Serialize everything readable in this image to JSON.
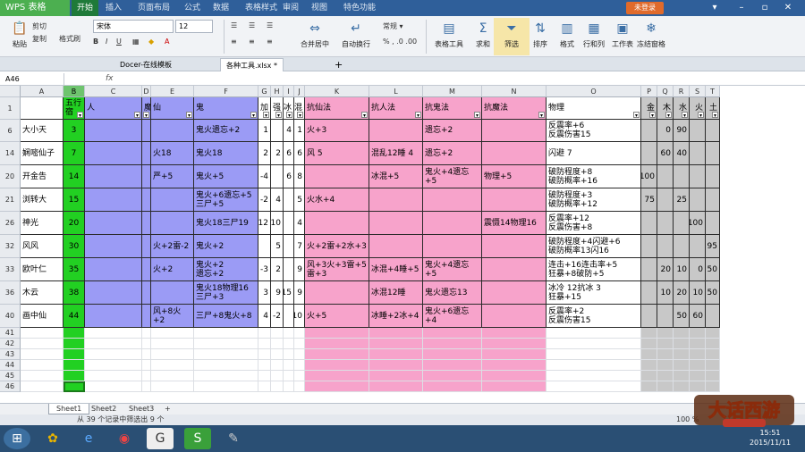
{
  "app": {
    "name": "WPS 表格",
    "menu_tabs": [
      "开始",
      "插入",
      "页面布局",
      "公式",
      "数据",
      "表格样式",
      "审阅",
      "视图",
      "特色功能"
    ],
    "login_label": "未登录"
  },
  "ribbon": {
    "paste": "粘贴",
    "cut": "剪切",
    "copy": "复制",
    "format_painter": "格式刷",
    "font_name": "宋体",
    "font_size": "12",
    "merge_center": "合并居中",
    "wrap_text": "自动换行",
    "sum": "求和",
    "filter": "筛选",
    "sort": "排序",
    "format": "格式",
    "row_col": "行和列",
    "worksheet": "工作表",
    "freeze": "冻结窗格",
    "insert_del": "表格工具",
    "condition": "条件格式"
  },
  "doc_tabs": [
    "Docer-在线模板",
    "各种工具.xlsx *"
  ],
  "formula_bar": {
    "name_box": "A46",
    "fx": "fx"
  },
  "columns": [
    {
      "id": "A",
      "sel": false
    },
    {
      "id": "B",
      "sel": true
    },
    {
      "id": "C",
      "sel": false
    },
    {
      "id": "D",
      "sel": false
    },
    {
      "id": "E",
      "sel": false
    },
    {
      "id": "F",
      "sel": false
    },
    {
      "id": "G",
      "sel": false
    },
    {
      "id": "H",
      "sel": false
    },
    {
      "id": "I",
      "sel": false
    },
    {
      "id": "J",
      "sel": false
    },
    {
      "id": "K",
      "sel": false
    },
    {
      "id": "L",
      "sel": false
    },
    {
      "id": "M",
      "sel": false
    },
    {
      "id": "N",
      "sel": false
    },
    {
      "id": "O",
      "sel": false
    },
    {
      "id": "P",
      "sel": false
    },
    {
      "id": "Q",
      "sel": false
    },
    {
      "id": "R",
      "sel": false
    },
    {
      "id": "S",
      "sel": false
    },
    {
      "id": "T",
      "sel": false
    }
  ],
  "header_row": {
    "row": "1",
    "cells": [
      "",
      "五行宿",
      "人",
      "魔",
      "仙",
      "鬼",
      "加",
      "强",
      "冰",
      "混",
      "抗仙法",
      "抗人法",
      "抗鬼法",
      "抗魔法",
      "物理",
      "金",
      "木",
      "水",
      "火",
      "土"
    ]
  },
  "rows": [
    {
      "row": "6",
      "cells": [
        "大小天",
        "3",
        "",
        "",
        "",
        "鬼火遗忘+2",
        "1",
        "",
        "4",
        "1",
        "火+3",
        "",
        "遗忘+2",
        "",
        "反震率+6\n反震伤害15",
        "",
        "0",
        "90",
        "",
        ""
      ]
    },
    {
      "row": "14",
      "cells": [
        "娴嘧仙子",
        "7",
        "",
        "",
        "火18",
        "鬼火18",
        "2",
        "2",
        "6",
        "6",
        "风 5",
        "混乱12睡 4",
        "遗忘+2",
        "",
        "闪避 7",
        "",
        "60",
        "40",
        "",
        ""
      ]
    },
    {
      "row": "20",
      "cells": [
        "开金告",
        "14",
        "",
        "",
        "严+5",
        "鬼火+5",
        "-4",
        "",
        "6",
        "8",
        "",
        "冰混+5",
        "鬼火+4遗忘+5",
        "物理+5",
        "破防程度+8\n破防概率+16",
        "100",
        "",
        "",
        "",
        ""
      ]
    },
    {
      "row": "21",
      "cells": [
        "浏转大",
        "15",
        "",
        "",
        "",
        "鬼火+6遗忘+5\n三尸+5",
        "-2",
        "4",
        "",
        "5",
        "火水+4",
        "",
        "",
        "",
        "破防程度+3\n破防概率+12",
        "75",
        "",
        "25",
        "",
        ""
      ]
    },
    {
      "row": "26",
      "cells": [
        "神光",
        "20",
        "",
        "",
        "",
        "鬼火18三尸19",
        "12",
        "10",
        "",
        "4",
        "",
        "",
        "",
        "震慑14物理16",
        "反震率+12\n反震伤害+8",
        "",
        "",
        "",
        "100",
        ""
      ]
    },
    {
      "row": "32",
      "cells": [
        "风风",
        "30",
        "",
        "",
        "火+2雷-2",
        "鬼火+2",
        "",
        "5",
        "",
        "7",
        "火+2雷+2水+3",
        "",
        "",
        "",
        "破防程度+4闪避+6\n破防概率13闪16",
        "",
        "",
        "",
        "",
        "95"
      ]
    },
    {
      "row": "33",
      "cells": [
        "欧叶仁",
        "35",
        "",
        "",
        "火+2",
        "鬼火+2\n遗忘+2",
        "-3",
        "2",
        "",
        "9",
        "风+3火+3雷+5\n雷+3",
        "冰混+4睡+5",
        "鬼火+4遗忘+5",
        "",
        "连击+16连击率+5\n狂暴+8破防+5",
        "",
        "20",
        "10",
        "0",
        "50"
      ]
    },
    {
      "row": "36",
      "cells": [
        "木云",
        "38",
        "",
        "",
        "",
        "鬼火18物理16\n三尸+3",
        "3",
        "9",
        "15",
        "9",
        "",
        "冰混12睡",
        "鬼火遗忘13",
        "",
        "冰冷 12抗冰 3\n狂暴+15",
        "",
        "10",
        "20",
        "10",
        "50"
      ]
    },
    {
      "row": "40",
      "cells": [
        "画中仙",
        "44",
        "",
        "",
        "风+8火+2",
        "三尸+8鬼火+8",
        "4",
        "-2",
        "",
        "10",
        "火+5",
        "冰睡+2冰+4",
        "鬼火+6遗忘+4",
        "",
        "反震率+2\n反震伤害15",
        "",
        "",
        "50",
        "60",
        ""
      ]
    }
  ],
  "empty_rows": [
    "41",
    "42",
    "43",
    "44",
    "45",
    "46"
  ],
  "sheets": [
    "Sheet1",
    "Sheet2",
    "Sheet3"
  ],
  "status_text": "从 39 个记录中筛选出 9 个",
  "zoom": "100 %",
  "clock": {
    "time": "15:51",
    "date": "2015/11/11"
  },
  "game_logo_text": "大话西游",
  "colors": {
    "green": "#22d022",
    "blue": "#9b9bf5",
    "pink": "#f7a3cb",
    "gray": "#c8c8c8",
    "titlebar": "#2f5f9a",
    "taskbar": "#2a4f74"
  }
}
